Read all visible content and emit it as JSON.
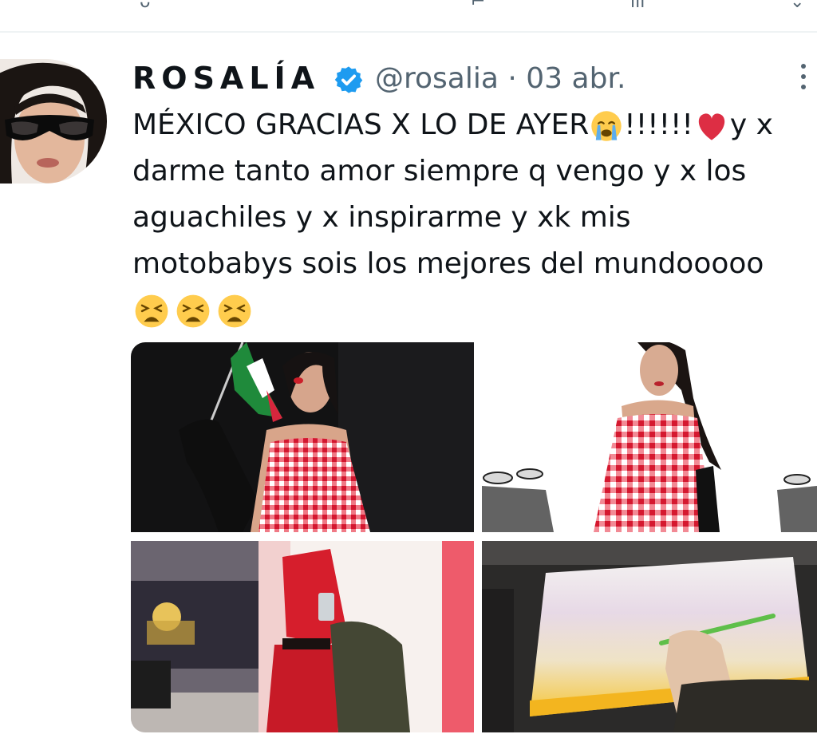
{
  "tweet": {
    "author_name": "ROSALÍA",
    "handle": "@rosalia",
    "separator": "·",
    "date": "03 abr.",
    "lines": [
      "MÉXICO GRACIAS X LO DE AYER",
      "!!!!!!",
      "y x",
      "darme tanto amor siempre q vengo y x los",
      "aguachiles y x inspirarme y xk mis",
      "motobabys sois los mejores del mundooooo"
    ],
    "icons": [
      "crying-face-emoji",
      "red-heart-emoji",
      "weary-face-emoji",
      "verified-badge-icon",
      "more-options-icon"
    ]
  },
  "colors": {
    "verified": "#1d9bf0",
    "secondary_text": "#536471",
    "gingham_red": "#e2233a"
  }
}
